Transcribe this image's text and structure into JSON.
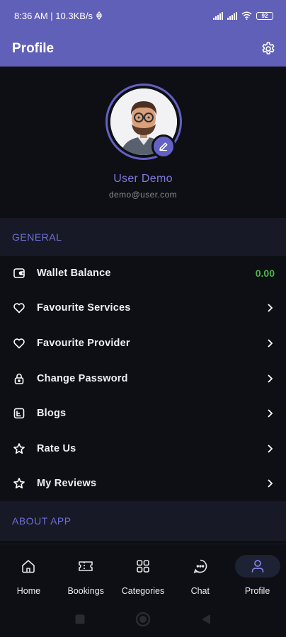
{
  "status_bar": {
    "time_speed": "8:36 AM | 10.3KB/s",
    "battery": "92"
  },
  "app_bar": {
    "title": "Profile"
  },
  "profile": {
    "name": "User Demo",
    "email": "demo@user.com"
  },
  "sections": {
    "general": "GENERAL",
    "about": "ABOUT APP"
  },
  "menu": [
    {
      "label": "Wallet Balance",
      "icon": "wallet-icon",
      "value": "0.00"
    },
    {
      "label": "Favourite Services",
      "icon": "heart-icon"
    },
    {
      "label": "Favourite Provider",
      "icon": "heart-icon"
    },
    {
      "label": "Change Password",
      "icon": "lock-icon"
    },
    {
      "label": "Blogs",
      "icon": "blog-icon"
    },
    {
      "label": "Rate Us",
      "icon": "star-icon"
    },
    {
      "label": "My Reviews",
      "icon": "star-icon"
    }
  ],
  "bottom_nav": [
    {
      "label": "Home",
      "icon": "home-icon"
    },
    {
      "label": "Bookings",
      "icon": "ticket-icon"
    },
    {
      "label": "Categories",
      "icon": "grid-icon"
    },
    {
      "label": "Chat",
      "icon": "chat-icon"
    },
    {
      "label": "Profile",
      "icon": "user-icon",
      "active": true
    }
  ],
  "colors": {
    "accent": "#6160b8",
    "accent_text": "#7d7be0",
    "wallet_value": "#4fb34f",
    "background": "#0e0f14",
    "section_bg": "#171a26"
  }
}
